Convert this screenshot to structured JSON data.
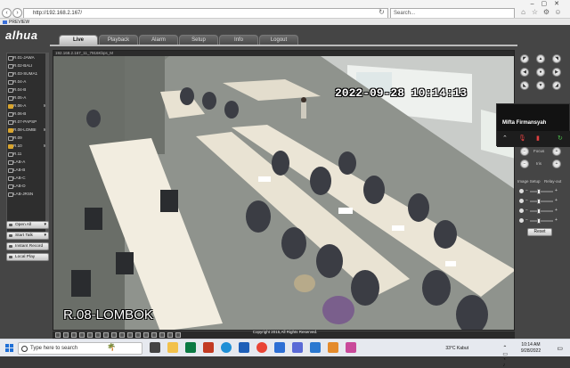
{
  "browser": {
    "address": "http://192.168.2.167/",
    "search_placeholder": "Search...",
    "tab_title": "PREVIEW"
  },
  "app": {
    "logo": "alhua",
    "menu": [
      {
        "label": "Live",
        "active": true
      },
      {
        "label": "Playback",
        "active": false
      },
      {
        "label": "Alarm",
        "active": false
      },
      {
        "label": "Setup",
        "active": false
      },
      {
        "label": "Info",
        "active": false
      },
      {
        "label": "Logout",
        "active": false
      }
    ],
    "channels": [
      {
        "label": "R.01-JAWA",
        "marker": ""
      },
      {
        "label": "R.02-BALI",
        "marker": ""
      },
      {
        "label": "R.03-SUMA1",
        "marker": ""
      },
      {
        "label": "R.04-A",
        "marker": ""
      },
      {
        "label": "R.04-B",
        "marker": ""
      },
      {
        "label": "R.05-A",
        "marker": ""
      },
      {
        "label": "R.06-A",
        "marker": "M"
      },
      {
        "label": "R.06-B",
        "marker": ""
      },
      {
        "label": "R.07-PAPSP",
        "marker": ""
      },
      {
        "label": "R.08-LOMBI",
        "marker": "M"
      },
      {
        "label": "R.09",
        "marker": ""
      },
      {
        "label": "R.10",
        "marker": "M"
      },
      {
        "label": "R.11",
        "marker": ""
      },
      {
        "label": "LAB-A",
        "marker": ""
      },
      {
        "label": "LAB-B",
        "marker": ""
      },
      {
        "label": "LAB-C",
        "marker": ""
      },
      {
        "label": "LAB-D",
        "marker": ""
      },
      {
        "label": "LAB-JRSN",
        "marker": ""
      }
    ],
    "buttons": {
      "open_all": "Open All",
      "start_talk": "Start Talk",
      "instant_record": "Instant Record",
      "local_play": "Local Play"
    },
    "video": {
      "header": "192.168.2.167_11_7916Kbps_M",
      "timestamp": "2022-09-28 10:14:13",
      "room_label": "R.08-LOMBOK"
    },
    "ptz": {
      "focus_label": "Focus",
      "iris_label": "Iris",
      "image_setup_label": "Image Setup",
      "relay_out_label": "Relay-out",
      "reset_label": "Reset"
    },
    "popup_user": "Mifta Firmansyah",
    "footer": "Copyright 2015,All Rights Reserved."
  },
  "taskbar": {
    "search_placeholder": "Type here to search",
    "weather": "33°C  Kabut",
    "time": "10:14 AM",
    "date": "9/28/2022"
  }
}
